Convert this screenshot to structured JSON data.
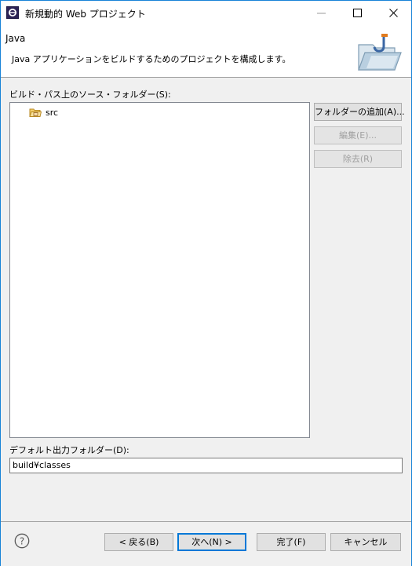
{
  "window": {
    "title": "新規動的 Web プロジェクト"
  },
  "header": {
    "title": "Java",
    "description": "Java アプリケーションをビルドするためのプロジェクトを構成します。"
  },
  "source_folders": {
    "label": "ビルド・パス上のソース・フォルダー(S):",
    "items": [
      {
        "label": "src",
        "icon": "source-folder-icon"
      }
    ]
  },
  "side_buttons": {
    "add_folder": "フォルダーの追加(A)...",
    "edit": "編集(E)...",
    "remove": "除去(R)"
  },
  "output_folder": {
    "label": "デフォルト出力フォルダー(D):",
    "value": "build¥classes"
  },
  "footer": {
    "help_icon": "help-icon",
    "back": "< 戻る(B)",
    "next": "次へ(N) >",
    "finish": "完了(F)",
    "cancel": "キャンセル"
  },
  "colors": {
    "window_border": "#1883d7",
    "default_button_border": "#0078d7",
    "disabled_text": "#a0a0a0"
  }
}
